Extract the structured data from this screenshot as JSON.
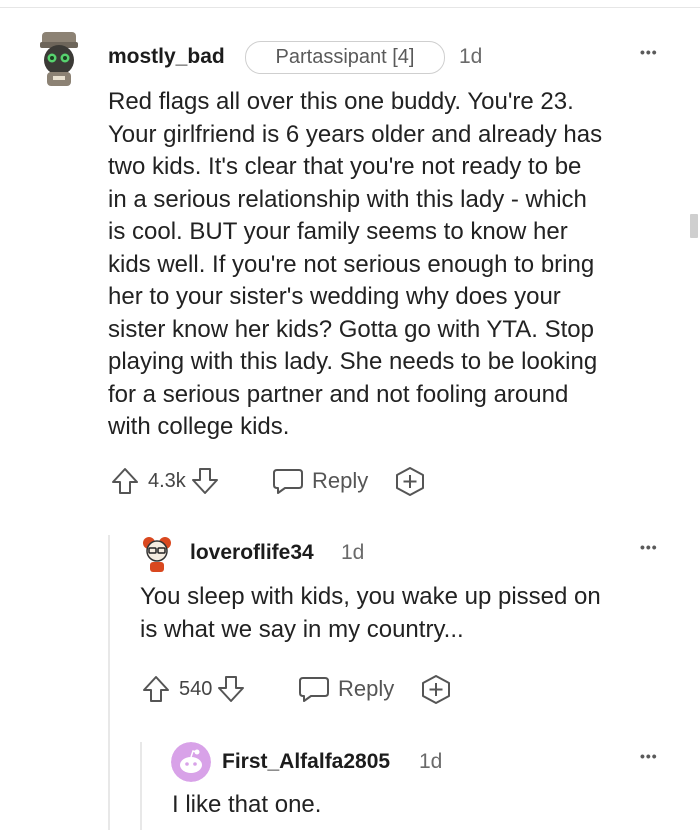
{
  "comments": [
    {
      "author": "mostly_bad",
      "flair": "Partassipant [4]",
      "age": "1d",
      "lines": [
        "Red flags all over this one buddy. You're 23.",
        "Your girlfriend is 6 years older and already has",
        "two kids. It's clear that you're not ready to be",
        "in a serious relationship with this lady - which",
        "is cool. BUT your family seems to know her",
        "kids well. If you're not serious enough to bring",
        "her to your sister's wedding why does your",
        "sister know her kids? Gotta go with YTA. Stop",
        "playing with this lady. She needs to be looking",
        "for a serious partner and not fooling around",
        "with college kids."
      ],
      "votes": "4.3k",
      "reply_label": "Reply"
    },
    {
      "author": "loveroflife34",
      "age": "1d",
      "lines": [
        "You sleep with kids, you wake up pissed on",
        "is what we say in my country..."
      ],
      "votes": "540",
      "reply_label": "Reply"
    },
    {
      "author": "First_Alfalfa2805",
      "age": "1d",
      "lines": [
        "I like that one."
      ]
    }
  ],
  "more_label": "•••",
  "icons": {
    "upvote": "upvote-arrow-icon",
    "downvote": "downvote-arrow-icon",
    "reply": "speech-bubble-icon",
    "award": "plus-circle-icon"
  },
  "colors": {
    "avatar3_bg": "#d8a2e8",
    "thread_line": "#e8e8e8"
  }
}
